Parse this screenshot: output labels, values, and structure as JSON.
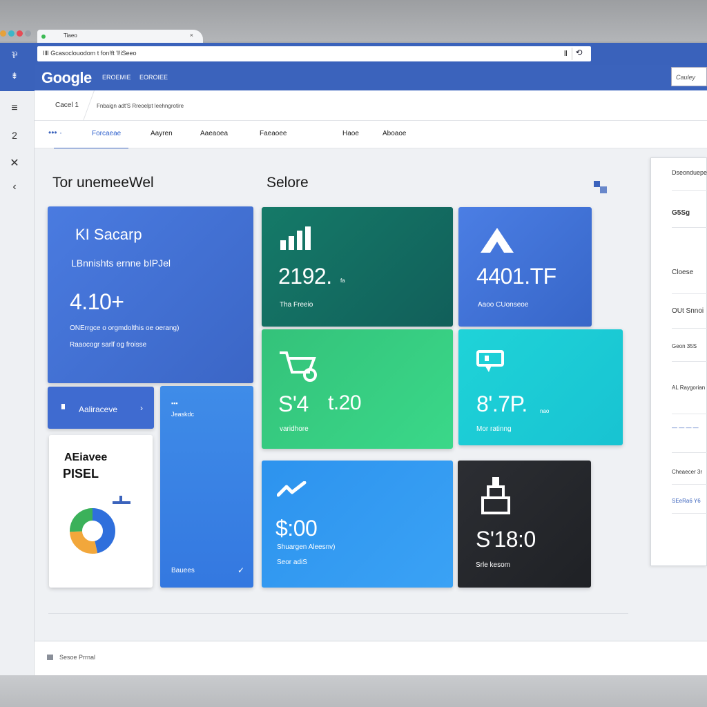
{
  "browser": {
    "tab_label": "Tiaeo",
    "tab_close": "×",
    "tab_side": "▾",
    "address_text": "IⅢ  Gcasoclouodom t fon!ft 'l!iSeeo",
    "address_icon_a": "Ⅱ",
    "address_icon_b": "⟲"
  },
  "rail": {
    "icon_a": "⅌",
    "icon_b": "⇟",
    "menu": "≡",
    "number": "2",
    "close": "✕",
    "back": "‹"
  },
  "header": {
    "logo": "Google",
    "links": [
      "EROEMIE",
      "EOROIEE"
    ],
    "country": "Cauley"
  },
  "subheader": {
    "tab": "Cacel 1",
    "text": "Fnbaign adt'S Rreoelpt leehngrotire"
  },
  "nav": {
    "dots": "••• ·",
    "items": [
      "Forcaeae",
      "Aayren",
      "Aaeaoea",
      "Faeaoee",
      "Haoe",
      "Aboaoe"
    ]
  },
  "sections": {
    "left_title": "Tor unemeeWel",
    "right_title": "Selore"
  },
  "cards": {
    "big": {
      "title": "KI Sacarp",
      "subtitle": "LBnnishts ernne bIPJel",
      "value": "4.10+",
      "line1": "ONErrgce o orgmdolthis oe oerang)",
      "line2": "Raaocogr sarlf og froisse"
    },
    "action": {
      "label": "Aaliraceve",
      "arrow": "›"
    },
    "pie": {
      "title_a": "AEiavee",
      "title_b": "PISEL"
    },
    "tall": {
      "top_label": "Jeaskdc",
      "bottom_label": "Bauees",
      "check": "✓"
    },
    "teal": {
      "value": "2192.",
      "value_suffix": "fa",
      "label": "Tha Freeio"
    },
    "blue_a": {
      "value": "4401.TF",
      "label": "Aaoo CUonseoe"
    },
    "green": {
      "value": "S'4",
      "value_b": "t.20",
      "label": "varidhore"
    },
    "cyan": {
      "value": "8'.7P.",
      "value_suffix": "nao",
      "label": "Mor ratinng"
    },
    "sky": {
      "value": "$:00",
      "line1": "Shuargen Aleesnv)",
      "line2": "Seor adiS"
    },
    "dark": {
      "value": "S'18:0",
      "label": "Srle kesom"
    }
  },
  "right_panel": {
    "title": "Dseonduepe",
    "items": [
      "G5Sg",
      "Cloese",
      "OUt Snnoi",
      "Geon 35S",
      "AL Raygorian",
      "— — — —",
      "Cheaecer 3r",
      "SEeRa6 Y6"
    ]
  },
  "footer": {
    "text": "Sesoe Prrnal"
  },
  "colors": {
    "brand_blue": "#3b63bc",
    "card_blue": "#4273d6",
    "teal": "#167565",
    "green": "#37c87e",
    "cyan": "#1fd3d8",
    "sky": "#2f9af0",
    "dark": "#25272c",
    "pie_blue": "#2f6fdc",
    "pie_green": "#3bb15a",
    "pie_orange": "#f2a73b"
  }
}
